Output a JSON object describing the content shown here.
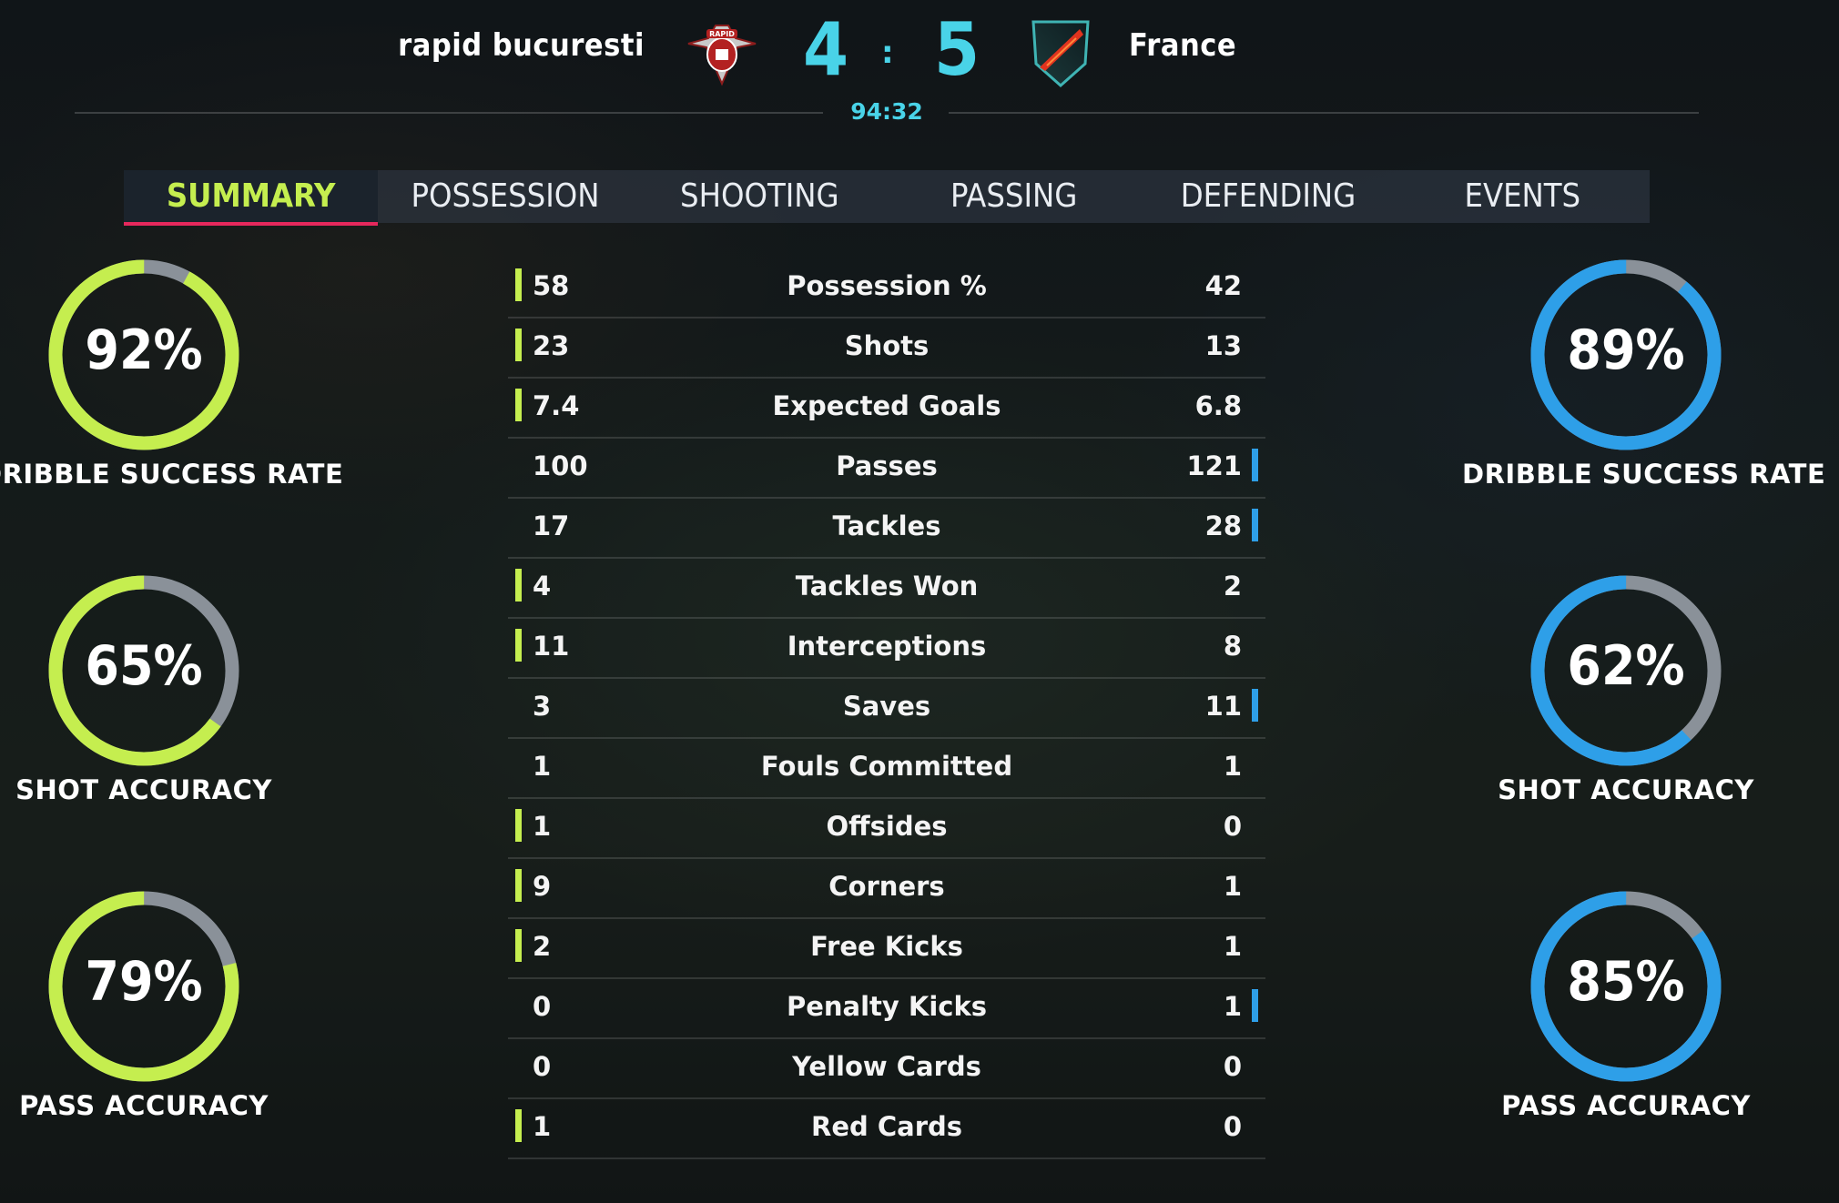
{
  "header": {
    "home_team": "rapid bucuresti",
    "away_team": "France",
    "home_score": "4",
    "away_score": "5",
    "separator": ":",
    "clock": "94:32",
    "crest_text": "RAPID"
  },
  "tabs": [
    "SUMMARY",
    "POSSESSION",
    "SHOOTING",
    "PASSING",
    "DEFENDING",
    "EVENTS"
  ],
  "active_tab": "SUMMARY",
  "colors": {
    "home_accent": "#c5ee4f",
    "away_accent": "#2e9fe8",
    "score": "#49d3e8",
    "tab_underline": "#e6285c",
    "gauge_track": "#8a9199"
  },
  "gauges": {
    "home": [
      {
        "label": "DRIBBLE SUCCESS RATE",
        "value": "92%",
        "fraction": 0.92
      },
      {
        "label": "SHOT ACCURACY",
        "value": "65%",
        "fraction": 0.65
      },
      {
        "label": "PASS ACCURACY",
        "value": "79%",
        "fraction": 0.79
      }
    ],
    "away": [
      {
        "label": "DRIBBLE SUCCESS RATE",
        "value": "89%",
        "fraction": 0.89
      },
      {
        "label": "SHOT ACCURACY",
        "value": "62%",
        "fraction": 0.62
      },
      {
        "label": "PASS ACCURACY",
        "value": "85%",
        "fraction": 0.85
      }
    ]
  },
  "stats": [
    {
      "label": "Possession %",
      "home": "58",
      "away": "42",
      "leader": "home"
    },
    {
      "label": "Shots",
      "home": "23",
      "away": "13",
      "leader": "home"
    },
    {
      "label": "Expected Goals",
      "home": "7.4",
      "away": "6.8",
      "leader": "home"
    },
    {
      "label": "Passes",
      "home": "100",
      "away": "121",
      "leader": "away"
    },
    {
      "label": "Tackles",
      "home": "17",
      "away": "28",
      "leader": "away"
    },
    {
      "label": "Tackles Won",
      "home": "4",
      "away": "2",
      "leader": "home"
    },
    {
      "label": "Interceptions",
      "home": "11",
      "away": "8",
      "leader": "home"
    },
    {
      "label": "Saves",
      "home": "3",
      "away": "11",
      "leader": "away"
    },
    {
      "label": "Fouls Committed",
      "home": "1",
      "away": "1",
      "leader": "none"
    },
    {
      "label": "Offsides",
      "home": "1",
      "away": "0",
      "leader": "home"
    },
    {
      "label": "Corners",
      "home": "9",
      "away": "1",
      "leader": "home"
    },
    {
      "label": "Free Kicks",
      "home": "2",
      "away": "1",
      "leader": "home"
    },
    {
      "label": "Penalty Kicks",
      "home": "0",
      "away": "1",
      "leader": "away"
    },
    {
      "label": "Yellow Cards",
      "home": "0",
      "away": "0",
      "leader": "none"
    },
    {
      "label": "Red Cards",
      "home": "1",
      "away": "0",
      "leader": "home"
    }
  ]
}
